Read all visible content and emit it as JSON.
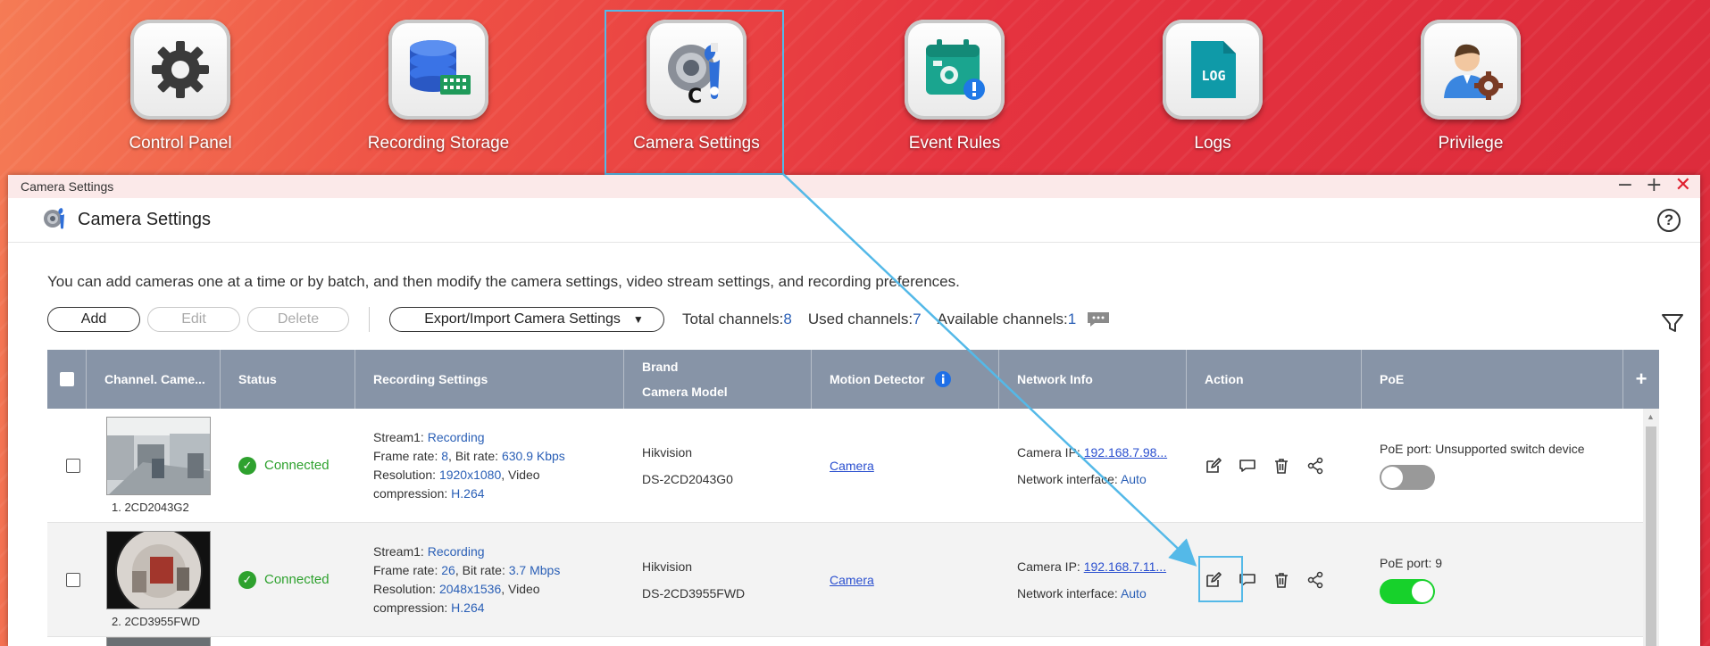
{
  "desktop": {
    "icons": [
      {
        "label": "Control Panel",
        "icon": "gear-icon"
      },
      {
        "label": "Recording Storage",
        "icon": "storage-icon"
      },
      {
        "label": "Camera Settings",
        "icon": "camera-settings-icon"
      },
      {
        "label": "Event Rules",
        "icon": "event-rules-icon"
      },
      {
        "label": "Logs",
        "icon": "logs-icon",
        "badge": "LOG"
      },
      {
        "label": "Privilege",
        "icon": "privilege-icon"
      }
    ],
    "cursor_char": "C"
  },
  "window": {
    "titlebar": "Camera Settings",
    "controls": {
      "minimize": "−",
      "maximize": "+",
      "close": "✕"
    },
    "header_title": "Camera Settings",
    "help": "?"
  },
  "description": "You can add cameras one at a time or by batch, and then modify the camera settings, video stream settings, and recording preferences.",
  "toolbar": {
    "add": "Add",
    "edit": "Edit",
    "delete": "Delete",
    "export_import": "Export/Import Camera Settings",
    "total_label": "Total channels:",
    "total": "8",
    "used_label": "Used channels:",
    "used": "7",
    "available_label": "Available channels:",
    "available": "1"
  },
  "table": {
    "headers": {
      "channel": "Channel. Came...",
      "status": "Status",
      "recording": "Recording Settings",
      "brand": "Brand",
      "model": "Camera Model",
      "motion": "Motion Detector",
      "network": "Network Info",
      "action": "Action",
      "poe": "PoE",
      "plus": "+"
    },
    "rows": [
      {
        "caption": "1. 2CD2043G2",
        "status": "Connected",
        "stream_label": "Stream1: ",
        "stream": "Recording",
        "fr_label": "Frame rate: ",
        "fr": "8",
        "br_label": ", Bit rate: ",
        "br": "630.9 Kbps",
        "res_label": "Resolution: ",
        "res": "1920x1080",
        "vc_label": ", Video",
        "comp_label": "compression: ",
        "comp": "H.264",
        "brand": "Hikvision",
        "model": "DS-2CD2043G0",
        "motion": "Camera",
        "ip_label": "Camera IP: ",
        "ip": "192.168.7.98...",
        "ni_label": "Network interface: ",
        "ni": "Auto",
        "poe": "PoE port: Unsupported switch device",
        "poe_on": false
      },
      {
        "caption": "2. 2CD3955FWD",
        "status": "Connected",
        "stream_label": "Stream1: ",
        "stream": "Recording",
        "fr_label": "Frame rate: ",
        "fr": "26",
        "br_label": ", Bit rate: ",
        "br": "3.7 Mbps",
        "res_label": "Resolution: ",
        "res": "2048x1536",
        "vc_label": ", Video",
        "comp_label": "compression: ",
        "comp": "H.264",
        "brand": "Hikvision",
        "model": "DS-2CD3955FWD",
        "motion": "Camera",
        "ip_label": "Camera IP: ",
        "ip": "192.168.7.11...",
        "ni_label": "Network interface: ",
        "ni": "Auto",
        "poe": "PoE port: 9",
        "poe_on": true
      }
    ]
  },
  "colors": {
    "accent_link": "#2a4fcf",
    "value_blue": "#2a5fb6",
    "connected_green": "#2ea12e",
    "toggle_on": "#17d12b",
    "highlight": "#54b9e8",
    "header_bg": "#8794a7"
  }
}
